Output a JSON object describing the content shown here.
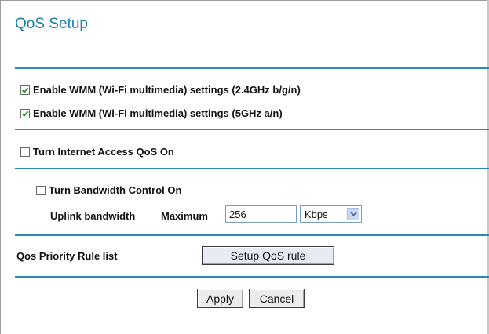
{
  "page": {
    "title": "QoS Setup"
  },
  "wmm": {
    "wmm24_label": "Enable WMM (Wi-Fi multimedia) settings (2.4GHz b/g/n)",
    "wmm24_checked": true,
    "wmm5_label": "Enable WMM (Wi-Fi multimedia) settings (5GHz a/n)",
    "wmm5_checked": true
  },
  "qos": {
    "internet_access_label": "Turn Internet Access QoS On",
    "internet_access_checked": false
  },
  "bandwidth": {
    "control_label": "Turn Bandwidth Control On",
    "control_checked": false,
    "uplink_label": "Uplink bandwidth",
    "maximum_label": "Maximum",
    "maximum_value": "256",
    "unit_selected": "Kbps"
  },
  "priority": {
    "rule_list_label": "Qos Priority Rule list",
    "setup_button": "Setup QoS rule"
  },
  "actions": {
    "apply": "Apply",
    "cancel": "Cancel"
  },
  "colors": {
    "accent": "#1d7ea4",
    "separator": "#2a8ab8"
  }
}
